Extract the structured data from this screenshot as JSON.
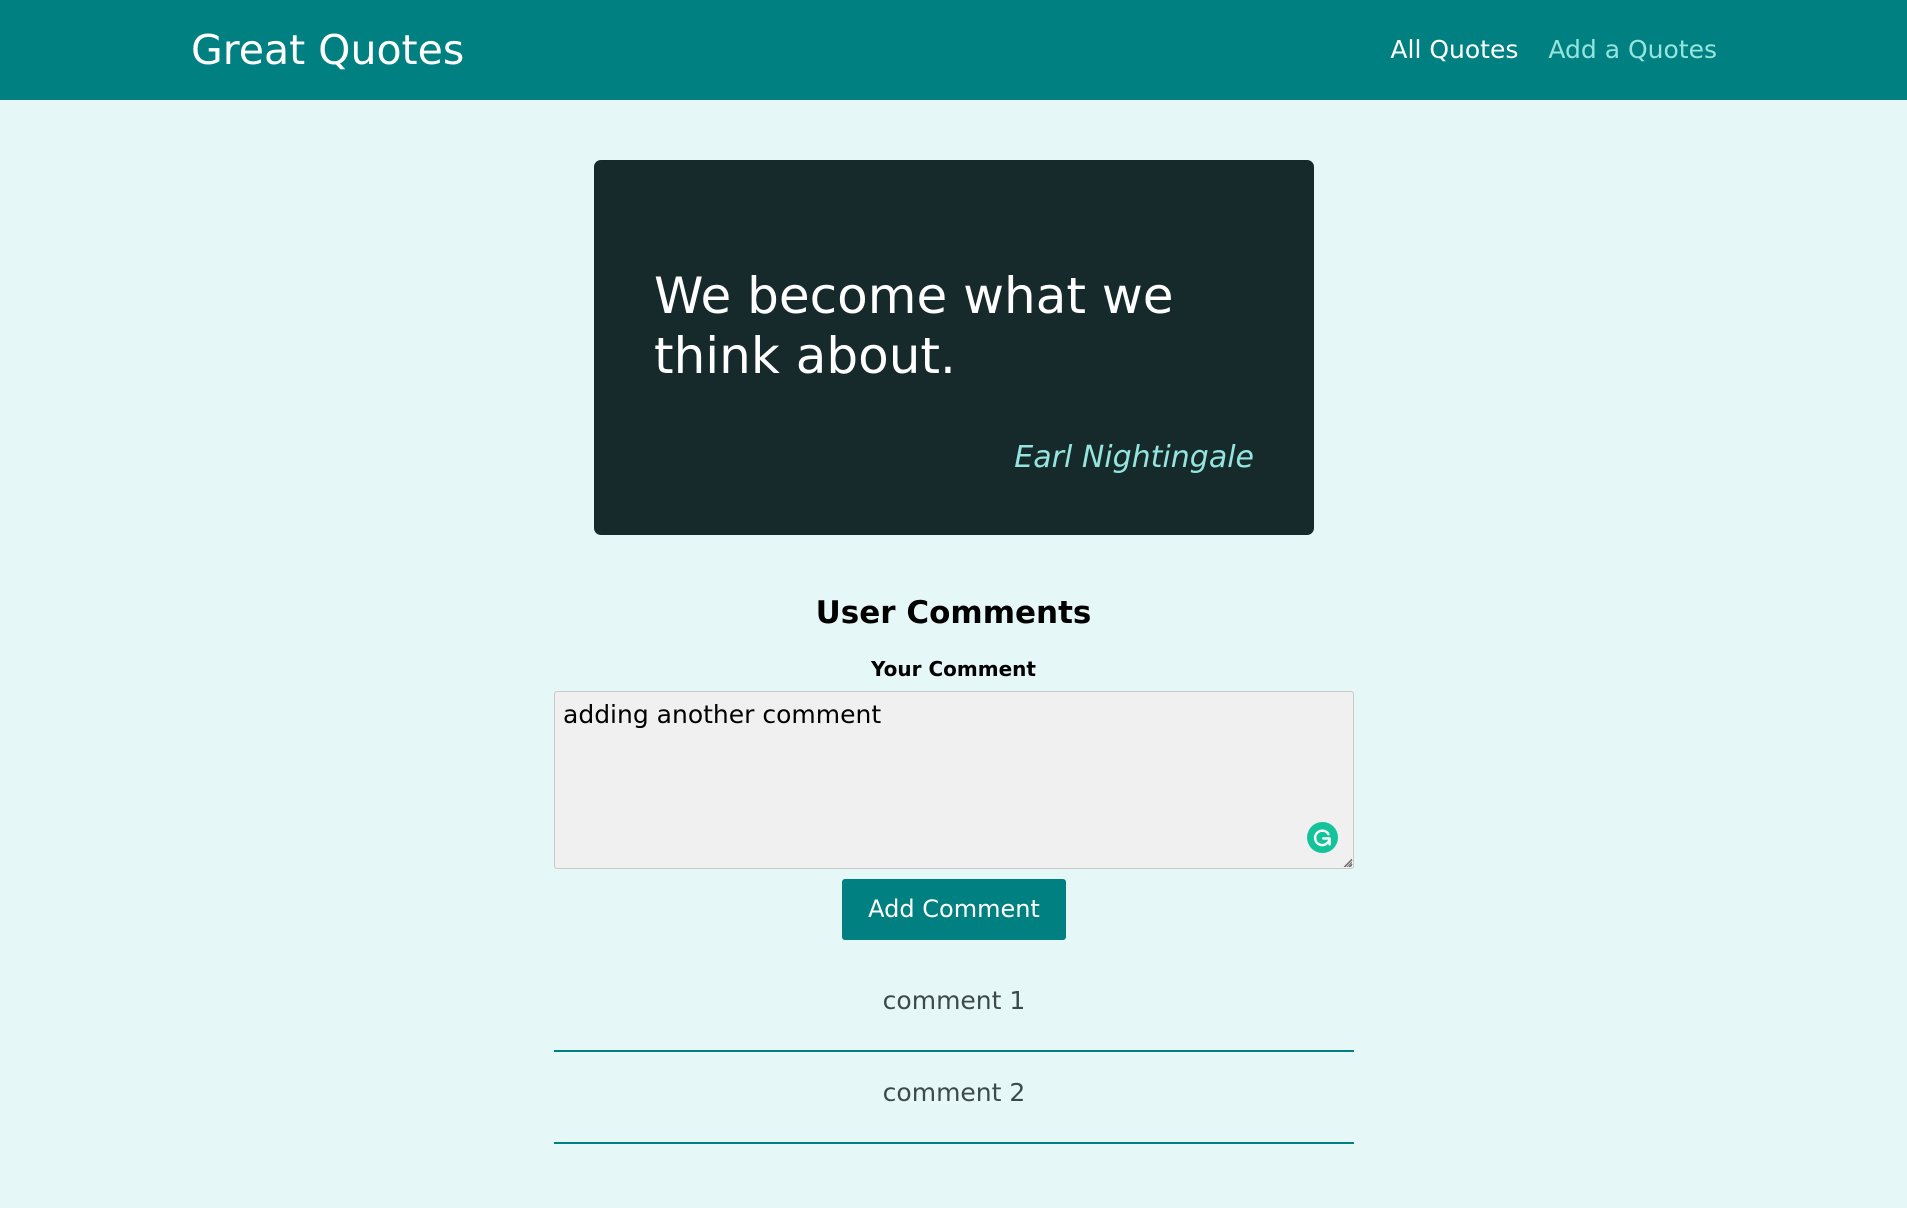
{
  "header": {
    "logo": "Great Quotes",
    "nav": [
      {
        "label": "All Quotes",
        "active": false
      },
      {
        "label": "Add a Quotes",
        "active": true
      }
    ]
  },
  "quote": {
    "text": "We become what we think about.",
    "author": "Earl Nightingale"
  },
  "comments": {
    "title": "User Comments",
    "input_label": "Your Comment",
    "input_value": "adding another comment",
    "submit_label": "Add Comment",
    "items": [
      "comment 1",
      "comment 2"
    ]
  },
  "colors": {
    "header_bg": "#008080",
    "page_bg": "#e6f7f7",
    "card_bg": "#172a2b",
    "accent_text": "#95e5de",
    "grammarly": "#15c39a"
  },
  "icons": {
    "grammarly": "grammarly-icon",
    "resize": "resize-grip-icon"
  }
}
